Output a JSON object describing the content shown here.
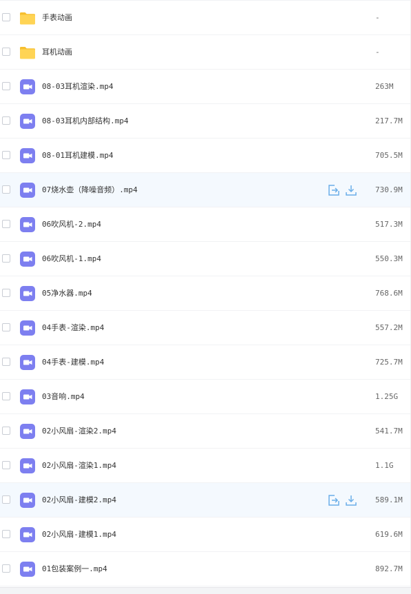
{
  "colors": {
    "folder": "#ffd455",
    "folder_tab": "#f7bf2f",
    "video": "#7d7ff0",
    "action": "#6aaee8",
    "hover_row": "#f4f9fe"
  },
  "icons": {
    "folder": "folder-icon",
    "video": "video-file-icon",
    "share": "share-icon",
    "download": "download-icon"
  },
  "files": [
    {
      "name": "手表动画",
      "size": "-",
      "type": "folder",
      "hover": false
    },
    {
      "name": "耳机动画",
      "size": "-",
      "type": "folder",
      "hover": false
    },
    {
      "name": "08-03耳机渲染.mp4",
      "size": "263M",
      "type": "video",
      "hover": false
    },
    {
      "name": "08-03耳机内部结构.mp4",
      "size": "217.7M",
      "type": "video",
      "hover": false
    },
    {
      "name": "08-01耳机建模.mp4",
      "size": "705.5M",
      "type": "video",
      "hover": false
    },
    {
      "name": "07烧水壶（降噪音频）.mp4",
      "size": "730.9M",
      "type": "video",
      "hover": true
    },
    {
      "name": "06吹风机-2.mp4",
      "size": "517.3M",
      "type": "video",
      "hover": false
    },
    {
      "name": "06吹风机-1.mp4",
      "size": "550.3M",
      "type": "video",
      "hover": false
    },
    {
      "name": "05净水器.mp4",
      "size": "768.6M",
      "type": "video",
      "hover": false
    },
    {
      "name": "04手表-渲染.mp4",
      "size": "557.2M",
      "type": "video",
      "hover": false
    },
    {
      "name": "04手表-建模.mp4",
      "size": "725.7M",
      "type": "video",
      "hover": false
    },
    {
      "name": "03音响.mp4",
      "size": "1.25G",
      "type": "video",
      "hover": false
    },
    {
      "name": "02小风扇-渲染2.mp4",
      "size": "541.7M",
      "type": "video",
      "hover": false
    },
    {
      "name": "02小风扇-渲染1.mp4",
      "size": "1.1G",
      "type": "video",
      "hover": false
    },
    {
      "name": "02小风扇-建模2.mp4",
      "size": "589.1M",
      "type": "video",
      "hover": true
    },
    {
      "name": "02小风扇-建模1.mp4",
      "size": "619.6M",
      "type": "video",
      "hover": false
    },
    {
      "name": "01包装案例一.mp4",
      "size": "892.7M",
      "type": "video",
      "hover": false
    }
  ]
}
